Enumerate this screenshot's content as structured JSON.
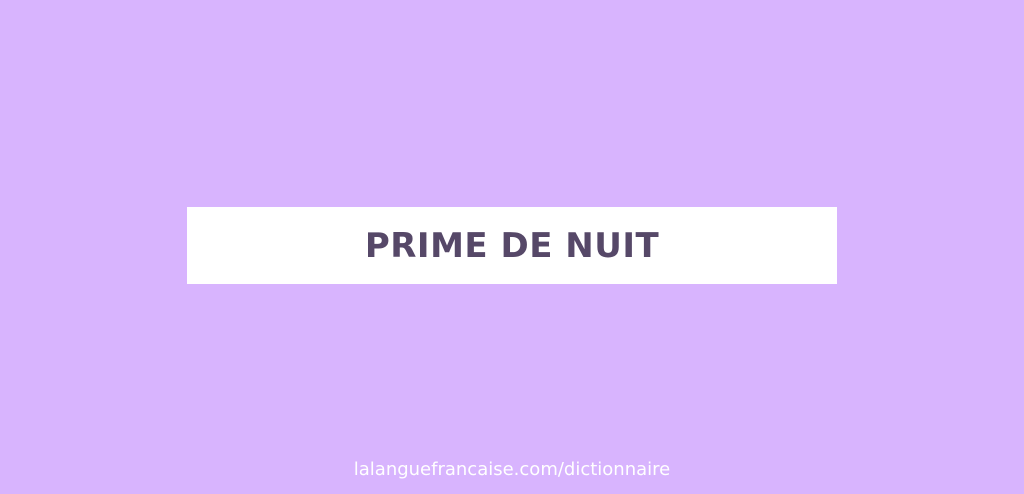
{
  "card": {
    "title": "PRIME DE NUIT"
  },
  "footer": {
    "url": "lalanguefrancaise.com/dictionnaire"
  },
  "colors": {
    "background": "#d8b4fe",
    "card_background": "#ffffff",
    "title_text": "#564868",
    "footer_text": "#ffffff"
  }
}
